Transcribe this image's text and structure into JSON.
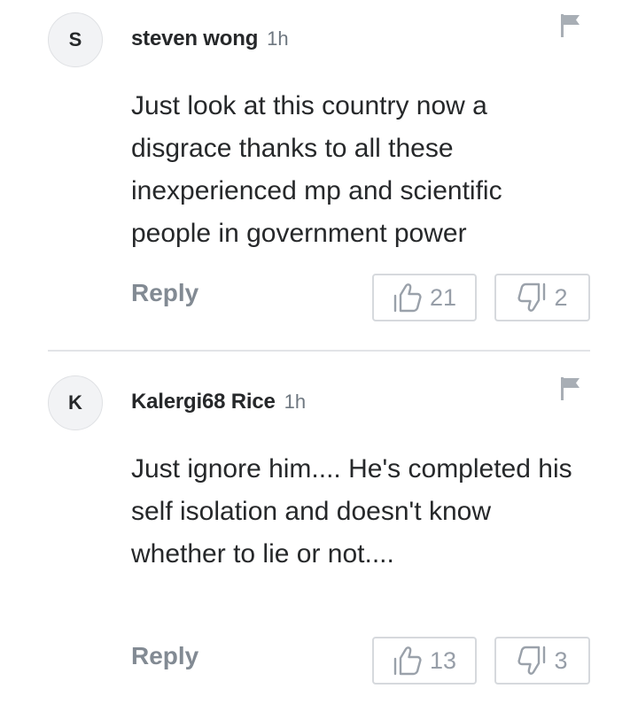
{
  "comments": [
    {
      "avatar_letter": "S",
      "username": "steven wong",
      "time": "1h",
      "text": "Just look at this country now a disgrace thanks to all these inexperienced mp and scientific people in government power",
      "reply_label": "Reply",
      "likes": "21",
      "dislikes": "2"
    },
    {
      "avatar_letter": "K",
      "username": "Kalergi68 Rice",
      "time": "1h",
      "text": "Just ignore him.... He's completed his self isolation and doesn't know whether to lie or not....",
      "reply_label": "Reply",
      "likes": "13",
      "dislikes": "3"
    }
  ],
  "icons": {
    "flag": "flag-icon",
    "like": "thumbs-up-icon",
    "dislike": "thumbs-down-icon"
  },
  "colors": {
    "text": "#26282a",
    "muted": "#828a93",
    "border": "#d6d9dd"
  }
}
